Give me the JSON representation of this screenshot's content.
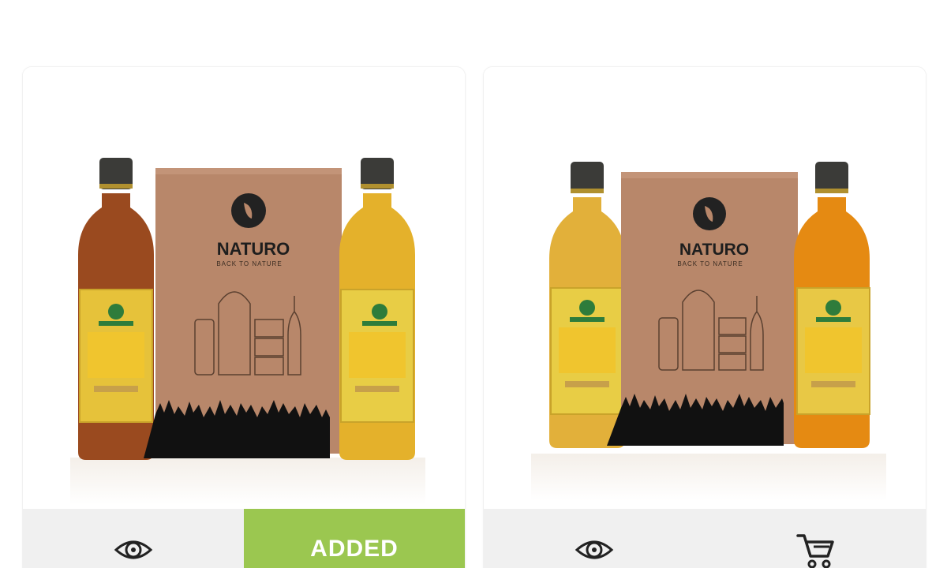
{
  "products": [
    {
      "brand_name": "NATURO",
      "brand_tagline": "BACK TO NATURE",
      "bottle_left_color": "#9a4a1f",
      "bottle_right_color": "#e4b12b",
      "actions": {
        "quick_view_icon": "eye-icon",
        "cart_label": "ADDED",
        "cart_state": "added"
      }
    },
    {
      "brand_name": "NATURO",
      "brand_tagline": "BACK TO NATURE",
      "bottle_left_color": "#e2b03a",
      "bottle_right_color": "#e58a12",
      "actions": {
        "quick_view_icon": "eye-icon",
        "cart_icon": "cart-icon",
        "cart_state": "not-added"
      }
    }
  ],
  "colors": {
    "accent_green": "#9bc750",
    "action_bar_bg": "#f0f0f0",
    "box_kraft": "#b8876a",
    "label_gold": "#e6c23a"
  }
}
